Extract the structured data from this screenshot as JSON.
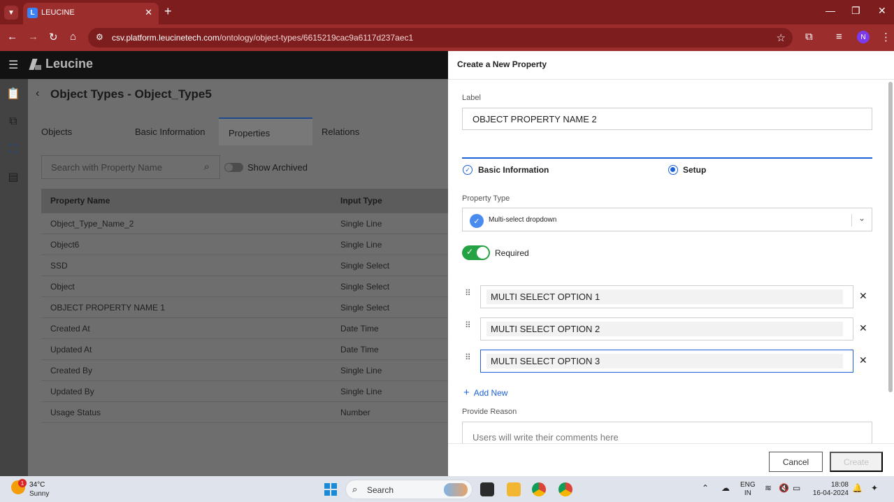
{
  "browser": {
    "tab_title": "LEUCINE",
    "url_host": "csv.platform.leucinetech.com",
    "url_path": "/ontology/object-types/6615219cac9a6117d237aec1",
    "profile_initial": "N"
  },
  "app": {
    "logo_text": "Leucine",
    "page_title": "Object Types - Object_Type5",
    "tabs": [
      "Objects",
      "Basic Information",
      "Properties",
      "Relations"
    ],
    "search_placeholder": "Search with Property Name",
    "show_archived_label": "Show Archived",
    "table": {
      "headers": [
        "Property Name",
        "Input Type"
      ],
      "rows": [
        [
          "Object_Type_Name_2",
          "Single Line"
        ],
        [
          "Object6",
          "Single Line"
        ],
        [
          "SSD",
          "Single Select"
        ],
        [
          "Object",
          "Single Select"
        ],
        [
          "OBJECT PROPERTY NAME 1",
          "Single Select"
        ],
        [
          "Created At",
          "Date Time"
        ],
        [
          "Updated At",
          "Date Time"
        ],
        [
          "Created By",
          "Single Line"
        ],
        [
          "Updated By",
          "Single Line"
        ],
        [
          "Usage Status",
          "Number"
        ]
      ]
    }
  },
  "drawer": {
    "title": "Create a New Property",
    "label_caption": "Label",
    "label_value": "OBJECT PROPERTY NAME 2",
    "steps": [
      "Basic Information",
      "Setup"
    ],
    "property_type_caption": "Property Type",
    "property_type_value": "Multi-select dropdown",
    "required_label": "Required",
    "options": [
      "MULTI SELECT OPTION 1",
      "MULTI SELECT OPTION 2",
      "MULTI SELECT OPTION 3"
    ],
    "add_new_label": "Add New",
    "reason_caption": "Provide Reason",
    "reason_placeholder": "Users will write their comments here",
    "cancel_label": "Cancel",
    "create_label": "Create"
  },
  "taskbar": {
    "weather_temp": "34°C",
    "weather_desc": "Sunny",
    "weather_badge": "1",
    "search_label": "Search",
    "lang_1": "ENG",
    "lang_2": "IN",
    "time": "18:08",
    "date": "16-04-2024"
  },
  "colors": {
    "browser_chrome": "#9b2d2d",
    "accent_blue": "#1c62d6",
    "required_green": "#25a244"
  }
}
